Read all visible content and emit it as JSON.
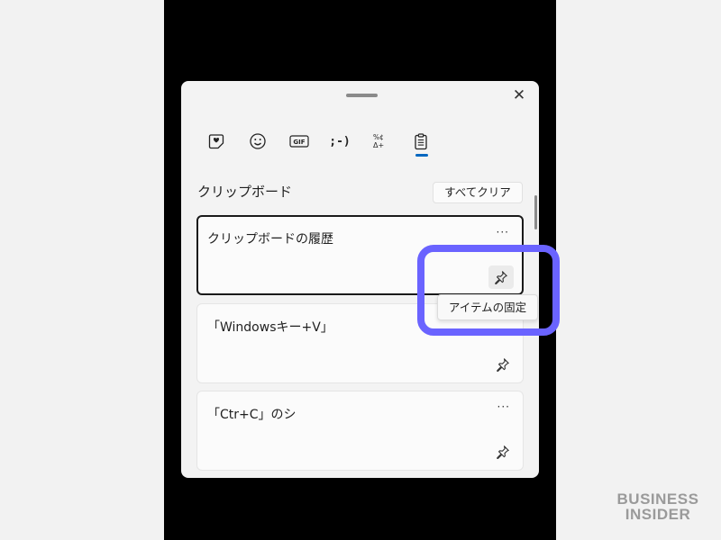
{
  "panel": {
    "close_label": "✕"
  },
  "tabs": [
    {
      "name": "kaomoji-favorites",
      "icon": "heart-sticker-icon"
    },
    {
      "name": "emoji",
      "icon": "smiley-icon"
    },
    {
      "name": "gif",
      "icon": "gif-icon",
      "label": "GIF"
    },
    {
      "name": "kaomoji",
      "icon": "kaomoji-icon",
      "label": ";-)"
    },
    {
      "name": "symbols",
      "icon": "symbols-icon",
      "label": "%¢\nΔ+"
    },
    {
      "name": "clipboard",
      "icon": "clipboard-icon",
      "active": true
    }
  ],
  "clipboard": {
    "title": "クリップボード",
    "clear_all_label": "すべてクリア",
    "items": [
      {
        "text": "クリップボードの履歴",
        "more": "···"
      },
      {
        "text": "「Windowsキー+V」",
        "more": "···"
      },
      {
        "text": "「Ctr+C」のシ",
        "more": "···"
      }
    ]
  },
  "tooltip": {
    "text": "アイテムの固定"
  },
  "brand": {
    "line1": "BUSINESS",
    "line2": "INSIDER"
  },
  "colors": {
    "accent": "#0067c0",
    "highlight": "#6a63ff"
  }
}
